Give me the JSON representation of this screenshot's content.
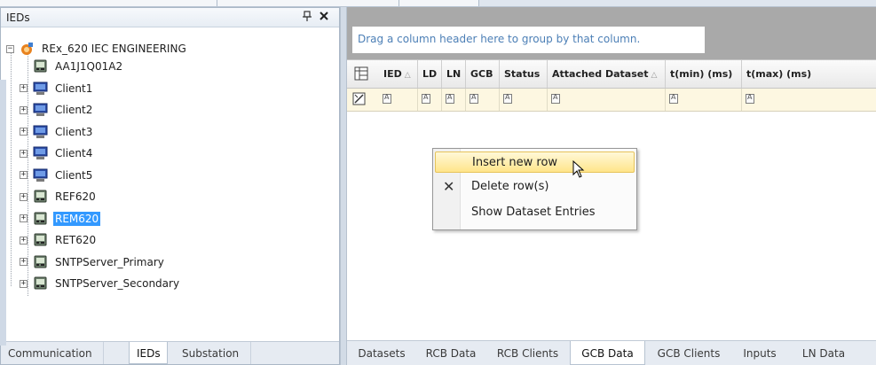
{
  "left_panel": {
    "title": "IEDs",
    "pin_glyph": "⊕",
    "close_glyph": "✕",
    "tree": {
      "root": {
        "label": "REx_620 IEC ENGINEERING",
        "icon": "engineering-root-icon",
        "expander": "−"
      },
      "items": [
        {
          "label": "AA1J1Q01A2",
          "icon": "ied-device-icon",
          "expandable": false
        },
        {
          "label": "Client1",
          "icon": "client-computer-icon",
          "expandable": true
        },
        {
          "label": "Client2",
          "icon": "client-computer-icon",
          "expandable": true
        },
        {
          "label": "Client3",
          "icon": "client-computer-icon",
          "expandable": true
        },
        {
          "label": "Client4",
          "icon": "client-computer-icon",
          "expandable": true
        },
        {
          "label": "Client5",
          "icon": "client-computer-icon",
          "expandable": true
        },
        {
          "label": "REF620",
          "icon": "ied-device-icon",
          "expandable": true
        },
        {
          "label": "REM620",
          "icon": "ied-device-icon",
          "expandable": true,
          "selected": true
        },
        {
          "label": "RET620",
          "icon": "ied-device-icon",
          "expandable": true
        },
        {
          "label": "SNTPServer_Primary",
          "icon": "ied-device-icon",
          "expandable": true
        },
        {
          "label": "SNTPServer_Secondary",
          "icon": "ied-device-icon",
          "expandable": true
        }
      ]
    },
    "tabs": [
      {
        "label": "Communication",
        "active": false
      },
      {
        "label": "IEDs",
        "active": true
      },
      {
        "label": "Substation",
        "active": false
      }
    ]
  },
  "right_panel": {
    "group_hint": "Drag a column header here to group by that column.",
    "columns": [
      {
        "label": "IED",
        "sorted": true
      },
      {
        "label": "LD",
        "sorted": false
      },
      {
        "label": "LN",
        "sorted": false
      },
      {
        "label": "GCB",
        "sorted": false
      },
      {
        "label": "Status",
        "sorted": false
      },
      {
        "label": "Attached Dataset",
        "sorted": true
      },
      {
        "label": "t(min) (ms)",
        "sorted": false
      },
      {
        "label": "t(max) (ms)",
        "sorted": false
      }
    ],
    "sort_glyph": "△",
    "tabs": [
      {
        "label": "Datasets",
        "active": false
      },
      {
        "label": "RCB Data",
        "active": false
      },
      {
        "label": "RCB Clients",
        "active": false
      },
      {
        "label": "GCB Data",
        "active": true
      },
      {
        "label": "GCB Clients",
        "active": false
      },
      {
        "label": "Inputs",
        "active": false
      },
      {
        "label": "LN Data",
        "active": false
      }
    ]
  },
  "context_menu": {
    "items": [
      {
        "label": "Insert new row",
        "highlighted": true,
        "icon": ""
      },
      {
        "label": "Delete row(s)",
        "highlighted": false,
        "icon": "delete-x-icon",
        "glyph": "✕"
      },
      {
        "label": "Show Dataset Entries",
        "highlighted": false,
        "icon": ""
      }
    ]
  },
  "colors": {
    "selection": "#3399ff",
    "group_area": "#a9a9a9",
    "group_hint_text": "#4c7fb6",
    "filter_row": "#fdf7e1",
    "menu_highlight": "#ffe58a"
  }
}
